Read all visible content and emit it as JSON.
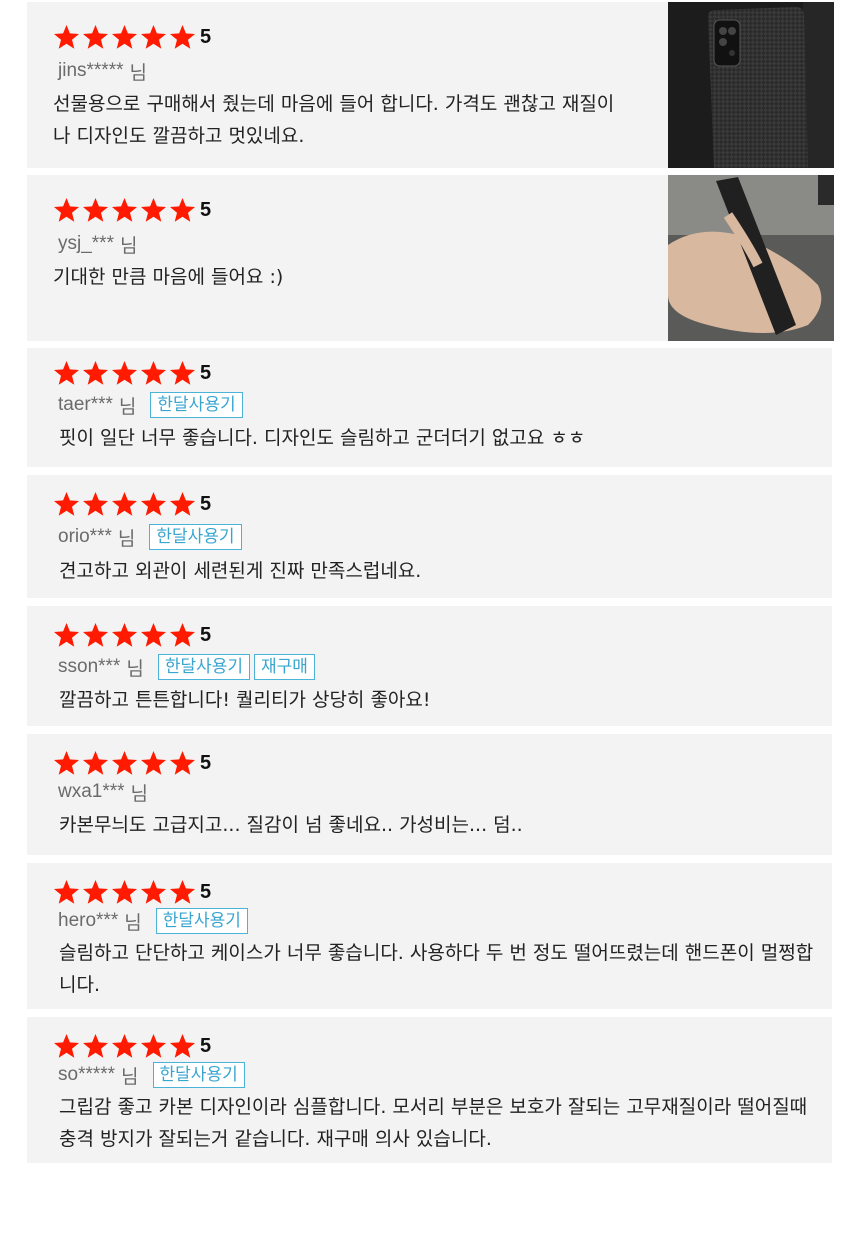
{
  "colors": {
    "star": "#ff1a00",
    "badge": "#3aa6d0",
    "card_bg": "#f3f3f3"
  },
  "reviews": [
    {
      "rating": "5",
      "user": "jins*****",
      "suffix": "님",
      "badges": [],
      "text": "선물용으로 구매해서 줬는데 마음에 들어 합니다. 가격도 괜찮고 재질이나 디자인도 깔끔하고 멋있네요.",
      "photo": "phone-case-photo-dark"
    },
    {
      "rating": "5",
      "user": "ysj_***",
      "suffix": "님",
      "badges": [],
      "text": "기대한 만큼 마음에 들어요 :)",
      "photo": "phone-case-in-hand-photo"
    },
    {
      "rating": "5",
      "user": "taer***",
      "suffix": "님",
      "badges": [
        "한달사용기"
      ],
      "text": "핏이 일단 너무 좋습니다. 디자인도 슬림하고 군더더기 없고요 ㅎㅎ"
    },
    {
      "rating": "5",
      "user": "orio***",
      "suffix": "님",
      "badges": [
        "한달사용기"
      ],
      "text": "견고하고 외관이 세련된게 진짜 만족스럽네요."
    },
    {
      "rating": "5",
      "user": "sson***",
      "suffix": "님",
      "badges": [
        "한달사용기",
        "재구매"
      ],
      "text": "깔끔하고 튼튼합니다! 퀄리티가 상당히 좋아요!"
    },
    {
      "rating": "5",
      "user": "wxa1***",
      "suffix": "님",
      "badges": [],
      "text": "카본무늬도 고급지고... 질감이 넘 좋네요.. 가성비는... 덤.."
    },
    {
      "rating": "5",
      "user": "hero***",
      "suffix": "님",
      "badges": [
        "한달사용기"
      ],
      "text": "슬림하고 단단하고 케이스가 너무 좋습니다. 사용하다 두 번 정도 떨어뜨렸는데 핸드폰이 멀쩡합니다."
    },
    {
      "rating": "5",
      "user": "so*****",
      "suffix": "님",
      "badges": [
        "한달사용기"
      ],
      "text": "그립감 좋고 카본 디자인이라 심플합니다. 모서리 부분은 보호가 잘되는 고무재질이라 떨어질때 충격 방지가 잘되는거 같습니다. 재구매 의사 있습니다."
    }
  ]
}
